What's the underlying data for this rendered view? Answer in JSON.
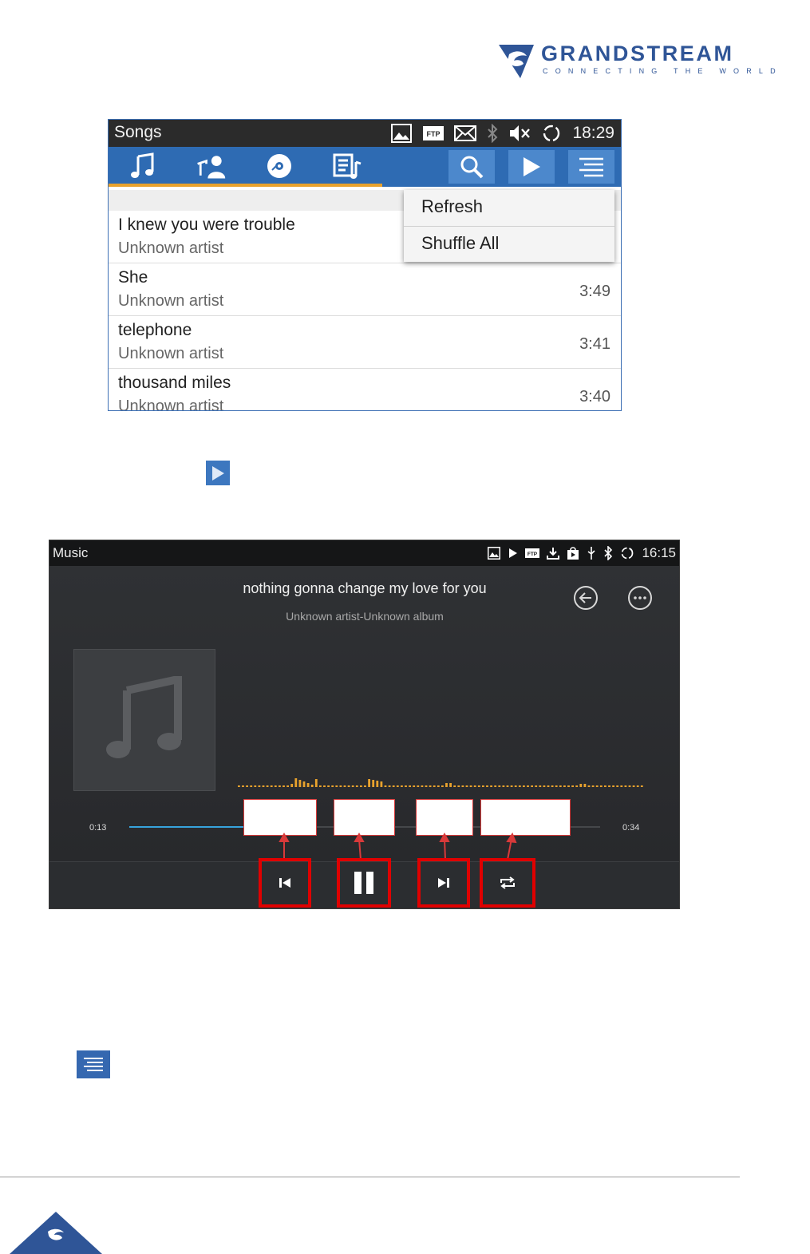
{
  "brand": {
    "name": "GRANDSTREAM",
    "tagline": "CONNECTING THE WORLD",
    "color": "#2f5597"
  },
  "songs_screen": {
    "status_title": "Songs",
    "time": "18:29",
    "status_icons": [
      "image-icon",
      "ftp-icon",
      "mail-icon",
      "bluetooth-icon",
      "mute-icon",
      "sync-icon"
    ],
    "tabs": [
      "songs-tab-icon",
      "artists-tab-icon",
      "albums-tab-icon",
      "playlists-tab-icon"
    ],
    "toolbar_buttons": [
      "search-icon",
      "play-icon",
      "menu-icon"
    ],
    "menu": {
      "items": [
        "Refresh",
        "Shuffle All"
      ]
    },
    "songs": [
      {
        "title": "I knew you were trouble",
        "artist": "Unknown artist",
        "duration": ""
      },
      {
        "title": "She",
        "artist": "Unknown artist",
        "duration": "3:49"
      },
      {
        "title": "telephone",
        "artist": "Unknown artist",
        "duration": "3:41"
      },
      {
        "title": "thousand miles",
        "artist": "Unknown artist",
        "duration": "3:40"
      }
    ],
    "accent_color": "#2e6bb3",
    "tab_indicator_color": "#e8a22d"
  },
  "player_screen": {
    "status_title": "Music",
    "time": "16:15",
    "status_icons": [
      "image-icon",
      "play-icon",
      "ftp-icon",
      "download-icon",
      "store-icon",
      "usb-icon",
      "bluetooth-icon",
      "sync-icon"
    ],
    "song_title": "nothing gonna change my love for you",
    "song_subtitle": "Unknown artist-Unknown album",
    "elapsed": "0:13",
    "duration": "0:34",
    "progress_fraction": 0.382,
    "controls": [
      "previous-icon",
      "pause-icon",
      "next-icon",
      "repeat-icon"
    ],
    "progress_color": "#37a3dc",
    "visualizer_color": "#e8a22d",
    "highlight_color": "#e00000"
  }
}
